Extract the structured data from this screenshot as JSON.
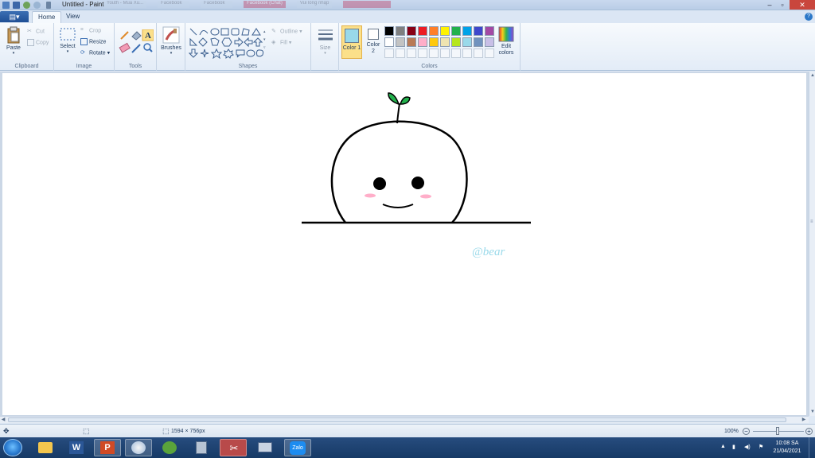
{
  "window": {
    "title": "Untitled - Paint",
    "bg_tabs": [
      "Youth - Mua Xu...",
      "",
      "Facebook",
      "",
      "Facebook",
      "Facebook (Chat)",
      "",
      "Vui lòng nhập",
      ""
    ]
  },
  "ribbon": {
    "tabs": [
      "Home",
      "View"
    ],
    "clipboard": {
      "paste": "Paste",
      "cut": "Cut",
      "copy": "Copy",
      "label": "Clipboard"
    },
    "image": {
      "select": "Select",
      "crop": "Crop",
      "resize": "Resize",
      "rotate": "Rotate",
      "label": "Image"
    },
    "tools": {
      "label": "Tools"
    },
    "brushes": {
      "label": "Brushes"
    },
    "shapes": {
      "outline": "Outline",
      "fill": "Fill",
      "label": "Shapes"
    },
    "size": {
      "label": "Size"
    },
    "colors": {
      "color1": "Color 1",
      "color2": "Color 2",
      "edit": "Edit colors",
      "label": "Colors",
      "color1_value": "#99d9ea",
      "color2_value": "#ffffff",
      "palette_row1": [
        "#000000",
        "#7f7f7f",
        "#880015",
        "#ed1c24",
        "#ff7f27",
        "#fff200",
        "#22b14c",
        "#00a2e8",
        "#3f48cc",
        "#a349a4"
      ],
      "palette_row2": [
        "#ffffff",
        "#c3c3c3",
        "#b97a57",
        "#ffaec9",
        "#ffc90e",
        "#efe4b0",
        "#b5e61d",
        "#99d9ea",
        "#7092be",
        "#c8bfe7"
      ]
    }
  },
  "canvas": {
    "watermark": "@bear",
    "colors": {
      "stroke": "#000000",
      "leaf": "#22b14c",
      "blush": "#ffaec9",
      "watermark": "#99d9ea"
    }
  },
  "status": {
    "dimensions": "1594 × 756px",
    "zoom": "100%"
  },
  "taskbar": {
    "apps": [
      "explorer-icon",
      "word-icon",
      "powerpoint-icon",
      "paint-icon",
      "app-icon",
      "calculator-icon",
      "snipping-icon",
      "network-icon",
      "zalo-icon"
    ],
    "zalo": "Zalo",
    "time": "10:08 SA",
    "date": "21/04/2021"
  }
}
